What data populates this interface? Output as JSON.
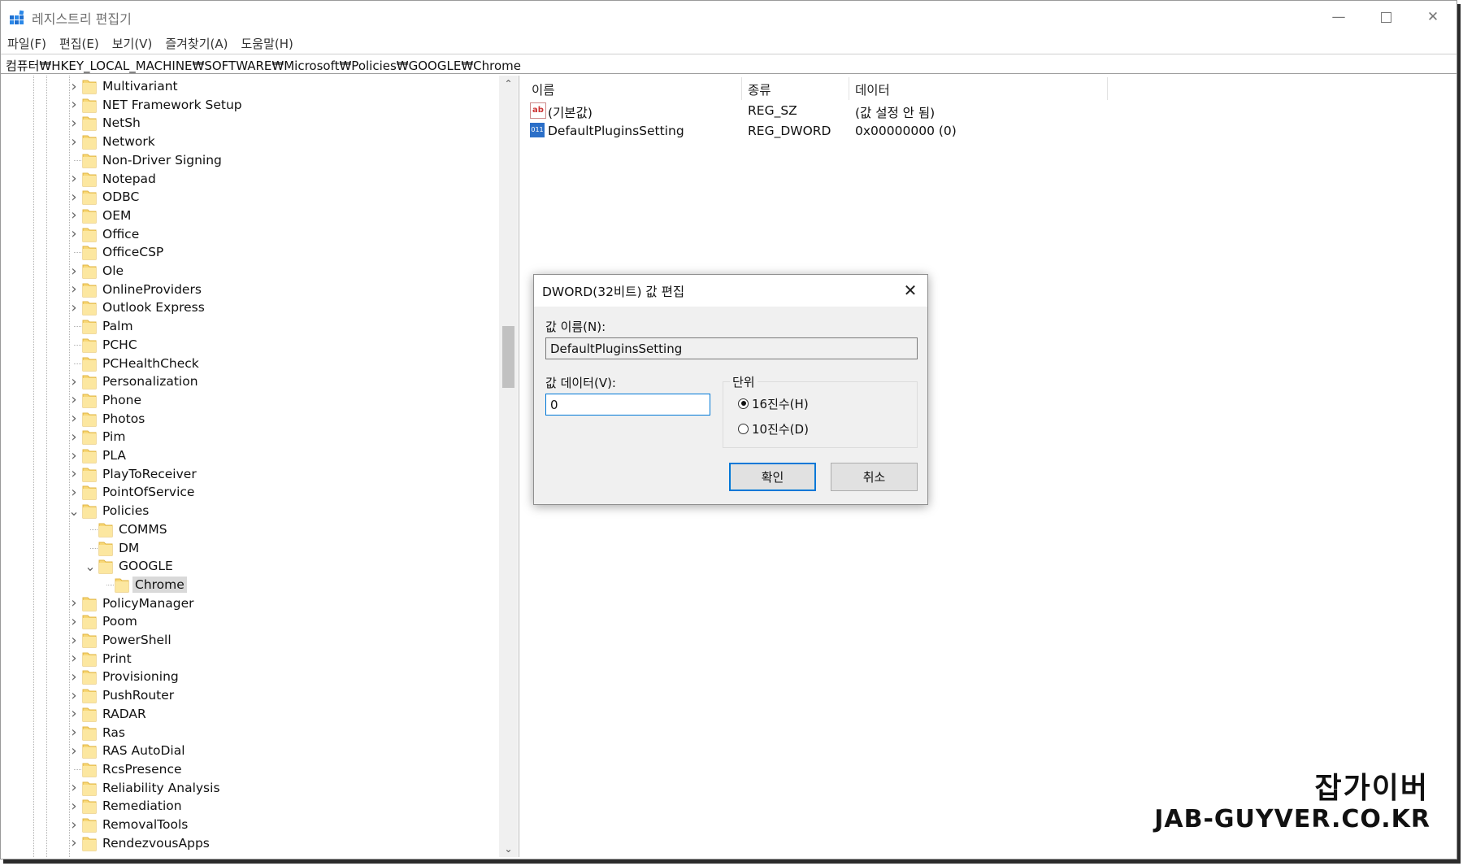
{
  "window": {
    "title": "레지스트리 편집기",
    "minimize_icon": "minimize-icon",
    "maximize_icon": "maximize-icon",
    "close_icon": "close-icon"
  },
  "menu": [
    "파일(F)",
    "편집(E)",
    "보기(V)",
    "즐겨찾기(A)",
    "도움말(H)"
  ],
  "address": "컴퓨터₩HKEY_LOCAL_MACHINE₩SOFTWARE₩Microsoft₩Policies₩GOOGLE₩Chrome",
  "tree": [
    {
      "label": "Multivariant",
      "level": 0,
      "expander": "collapsed"
    },
    {
      "label": "NET Framework Setup",
      "level": 0,
      "expander": "collapsed"
    },
    {
      "label": "NetSh",
      "level": 0,
      "expander": "collapsed"
    },
    {
      "label": "Network",
      "level": 0,
      "expander": "collapsed"
    },
    {
      "label": "Non-Driver Signing",
      "level": 0,
      "expander": "none"
    },
    {
      "label": "Notepad",
      "level": 0,
      "expander": "collapsed"
    },
    {
      "label": "ODBC",
      "level": 0,
      "expander": "collapsed"
    },
    {
      "label": "OEM",
      "level": 0,
      "expander": "collapsed"
    },
    {
      "label": "Office",
      "level": 0,
      "expander": "collapsed"
    },
    {
      "label": "OfficeCSP",
      "level": 0,
      "expander": "none"
    },
    {
      "label": "Ole",
      "level": 0,
      "expander": "collapsed"
    },
    {
      "label": "OnlineProviders",
      "level": 0,
      "expander": "collapsed"
    },
    {
      "label": "Outlook Express",
      "level": 0,
      "expander": "collapsed"
    },
    {
      "label": "Palm",
      "level": 0,
      "expander": "none"
    },
    {
      "label": "PCHC",
      "level": 0,
      "expander": "none"
    },
    {
      "label": "PCHealthCheck",
      "level": 0,
      "expander": "none"
    },
    {
      "label": "Personalization",
      "level": 0,
      "expander": "collapsed"
    },
    {
      "label": "Phone",
      "level": 0,
      "expander": "collapsed"
    },
    {
      "label": "Photos",
      "level": 0,
      "expander": "collapsed"
    },
    {
      "label": "Pim",
      "level": 0,
      "expander": "collapsed"
    },
    {
      "label": "PLA",
      "level": 0,
      "expander": "collapsed"
    },
    {
      "label": "PlayToReceiver",
      "level": 0,
      "expander": "collapsed"
    },
    {
      "label": "PointOfService",
      "level": 0,
      "expander": "collapsed"
    },
    {
      "label": "Policies",
      "level": 0,
      "expander": "expanded"
    },
    {
      "label": "COMMS",
      "level": 1,
      "expander": "none"
    },
    {
      "label": "DM",
      "level": 1,
      "expander": "none"
    },
    {
      "label": "GOOGLE",
      "level": 1,
      "expander": "expanded"
    },
    {
      "label": "Chrome",
      "level": 2,
      "expander": "none",
      "selected": true
    },
    {
      "label": "PolicyManager",
      "level": 0,
      "expander": "collapsed"
    },
    {
      "label": "Poom",
      "level": 0,
      "expander": "collapsed"
    },
    {
      "label": "PowerShell",
      "level": 0,
      "expander": "collapsed"
    },
    {
      "label": "Print",
      "level": 0,
      "expander": "collapsed"
    },
    {
      "label": "Provisioning",
      "level": 0,
      "expander": "collapsed"
    },
    {
      "label": "PushRouter",
      "level": 0,
      "expander": "collapsed"
    },
    {
      "label": "RADAR",
      "level": 0,
      "expander": "collapsed"
    },
    {
      "label": "Ras",
      "level": 0,
      "expander": "collapsed"
    },
    {
      "label": "RAS AutoDial",
      "level": 0,
      "expander": "collapsed"
    },
    {
      "label": "RcsPresence",
      "level": 0,
      "expander": "none"
    },
    {
      "label": "Reliability Analysis",
      "level": 0,
      "expander": "collapsed"
    },
    {
      "label": "Remediation",
      "level": 0,
      "expander": "collapsed"
    },
    {
      "label": "RemovalTools",
      "level": 0,
      "expander": "collapsed"
    },
    {
      "label": "RendezvousApps",
      "level": 0,
      "expander": "collapsed"
    }
  ],
  "values": {
    "columns": [
      "이름",
      "종류",
      "데이터"
    ],
    "rows": [
      {
        "name": "(기본값)",
        "type": "REG_SZ",
        "data": "(값 설정 안 됨)",
        "icon": "string-value-icon"
      },
      {
        "name": "DefaultPluginsSetting",
        "type": "REG_DWORD",
        "data": "0x00000000 (0)",
        "icon": "binary-value-icon"
      }
    ]
  },
  "dialog": {
    "title": "DWORD(32비트) 값 편집",
    "name_label": "값 이름(N):",
    "name_value": "DefaultPluginsSetting",
    "data_label": "값 데이터(V):",
    "data_value": "0",
    "base_label": "단위",
    "radio_hex": "16진수(H)",
    "radio_dec": "10진수(D)",
    "selected_base": "hex",
    "ok": "확인",
    "cancel": "취소"
  },
  "watermark": {
    "line1": "잡가이버",
    "line2": "JAB-GUYVER.CO.KR"
  }
}
